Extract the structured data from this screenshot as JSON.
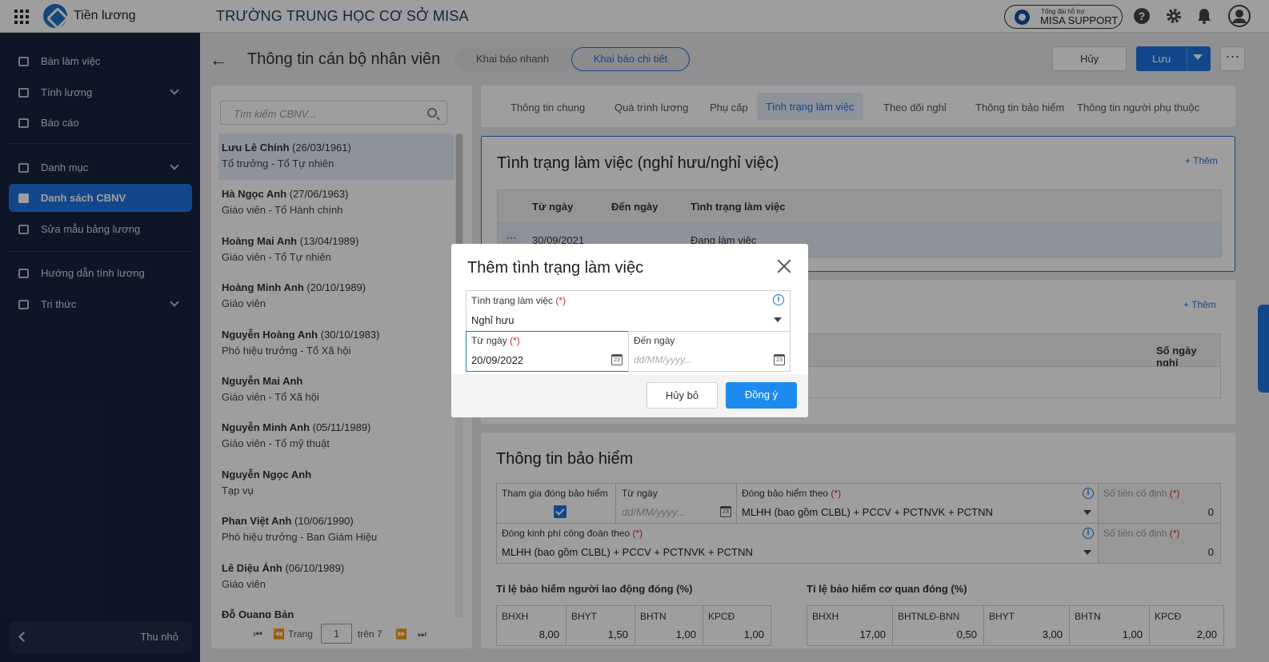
{
  "topbar": {
    "app_name": "Tiền lương",
    "school": "TRƯỜNG TRUNG HỌC CƠ SỞ MISA",
    "support_small": "Tổng đài hỗ trợ",
    "support_big": "MISA SUPPORT",
    "icons": [
      "help-icon",
      "settings-icon",
      "bell-icon",
      "user-icon"
    ]
  },
  "sidebar": {
    "items": [
      {
        "label": "Bàn làm việc",
        "icon": "dashboard-icon"
      },
      {
        "label": "Tính lương",
        "icon": "payroll-icon"
      },
      {
        "label": "Báo cáo",
        "icon": "report-icon"
      },
      {
        "label": "Danh mục",
        "icon": "list-icon"
      },
      {
        "label": "Danh sách CBNV",
        "icon": "staff-icon"
      },
      {
        "label": "Sửa mẫu bảng lương",
        "icon": "template-icon"
      },
      {
        "label": "Hướng dẫn tính lương",
        "icon": "guide-icon"
      },
      {
        "label": "Tri thức",
        "icon": "knowledge-icon"
      }
    ],
    "collapse_label": "Thu nhỏ"
  },
  "header": {
    "title": "Thông tin cán bộ nhân viên",
    "seg_quick": "Khai báo nhanh",
    "seg_detail": "Khai báo chi tiết",
    "cancel": "Hủy",
    "save": "Lưu"
  },
  "list": {
    "search_placeholder": "Tìm kiếm CBNV...",
    "employees": [
      {
        "name": "Lưu Lê Chính",
        "date": " (26/03/1961)",
        "role": "Tổ trưởng - Tổ Tự nhiên"
      },
      {
        "name": "Hà Ngọc Anh",
        "date": " (27/06/1963)",
        "role": "Giáo viên - Tổ Hành chính"
      },
      {
        "name": "Hoàng Mai Anh",
        "date": " (13/04/1989)",
        "role": "Giáo viên - Tổ Tự nhiên"
      },
      {
        "name": "Hoàng Minh Anh",
        "date": " (20/10/1989)",
        "role": "Giáo viên"
      },
      {
        "name": "Nguyễn Hoàng Anh",
        "date": " (30/10/1983)",
        "role": "Phó hiệu trưởng - Tổ Xã hội"
      },
      {
        "name": "Nguyễn Mai Anh",
        "date": "",
        "role": "Giáo viên - Tổ Xã hội"
      },
      {
        "name": "Nguyễn Minh Anh",
        "date": " (05/11/1989)",
        "role": "Giáo viên - Tổ mỹ thuật"
      },
      {
        "name": "Nguyễn Ngọc Anh",
        "date": "",
        "role": "Tạp vụ"
      },
      {
        "name": "Phan Việt Anh",
        "date": " (10/06/1990)",
        "role": "Phó hiệu trưởng - Ban Giám Hiệu"
      },
      {
        "name": "Lê Diệu Ánh",
        "date": " (06/10/1989)",
        "role": "Giáo viên"
      },
      {
        "name": "Đỗ Quang Bản",
        "date": "",
        "role": ""
      }
    ],
    "pager": {
      "page_label": "Trang",
      "page": "1",
      "of_label": "trên 7"
    }
  },
  "tabs": [
    "Thông tin chung",
    "Quá trình lương",
    "Phụ cấp",
    "Tình trạng làm việc",
    "Theo dõi nghỉ",
    "Thông tin bảo hiểm",
    "Thông tin người phụ thuộc"
  ],
  "work_status": {
    "title": "Tình trạng làm việc (nghỉ hưu/nghỉ việc)",
    "add": "+ Thêm",
    "headers": [
      "Từ ngày",
      "Đến ngày",
      "Tình trạng làm việc"
    ],
    "row": {
      "from": "30/09/2021",
      "to": "",
      "status": "Đang làm việc"
    }
  },
  "leave": {
    "add": "+ Thêm",
    "col": "Số ngày nghỉ"
  },
  "insurance": {
    "title": "Thông tin bảo hiểm",
    "join_label": "Tham gia đóng bảo hiểm",
    "from_label": "Từ ngày",
    "from_placeholder": "dd/MM/yyyy...",
    "pay_by_label": "Đóng bảo hiểm theo",
    "pay_by_value": "MLHH (bao gồm CLBL) + PCCV + PCTNVK + PCTNN",
    "fixed_label": "Số tiền cố định",
    "fixed_value": "0",
    "union_label": "Đóng kinh phí công đoàn theo",
    "union_value": "MLHH (bao gồm CLBL) + PCCV + PCTNVK + PCTNN",
    "fixed2_label": "Số tiền cố định",
    "fixed2_value": "0",
    "emp_rate_title": "Tỉ lệ bảo hiểm người lao động đóng (%)",
    "emp_rates": [
      {
        "k": "BHXH",
        "v": "8,00"
      },
      {
        "k": "BHYT",
        "v": "1,50"
      },
      {
        "k": "BHTN",
        "v": "1,00"
      },
      {
        "k": "KPCĐ",
        "v": "1,00"
      }
    ],
    "org_rate_title": "Tỉ lệ bảo hiểm cơ quan đóng (%)",
    "org_rates": [
      {
        "k": "BHXH",
        "v": "17,00"
      },
      {
        "k": "BHTNLĐ-BNN",
        "v": "0,50"
      },
      {
        "k": "BHYT",
        "v": "3,00"
      },
      {
        "k": "BHTN",
        "v": "1,00"
      },
      {
        "k": "KPCĐ",
        "v": "2,00"
      }
    ]
  },
  "modal": {
    "title": "Thêm tình trạng làm việc",
    "status_label": "Tình trạng làm việc",
    "required": "(*)",
    "status_value": "Nghỉ hưu",
    "from_label": "Từ ngày",
    "from_value": "20/09/2022",
    "to_label": "Đến ngày",
    "to_placeholder": "dd/MM/yyyy...",
    "cancel": "Hủy bỏ",
    "ok": "Đồng ý"
  },
  "colors": {
    "accent": "#1d74e0",
    "sidebar": "#17233f",
    "required": "#e02020"
  }
}
